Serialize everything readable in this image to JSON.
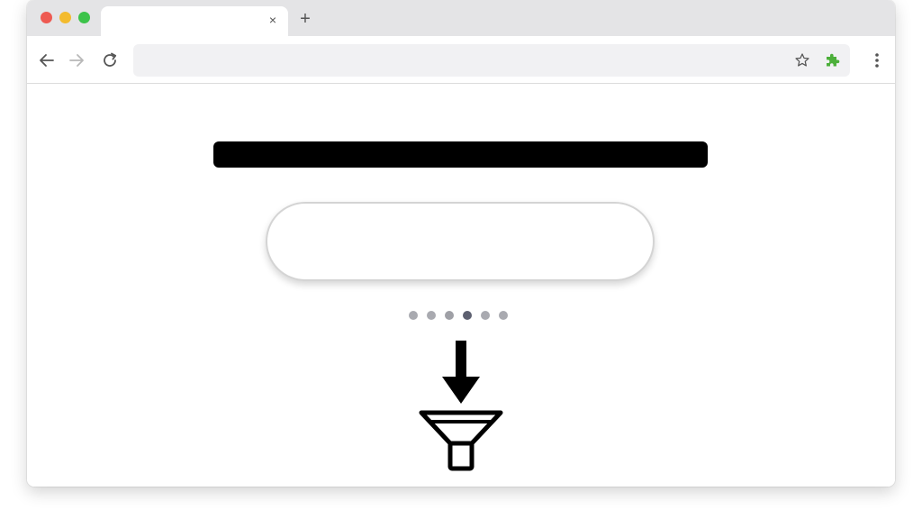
{
  "browser": {
    "tab": {
      "title": "",
      "close_glyph": "×"
    },
    "new_tab_glyph": "+",
    "address_bar": {
      "value": "",
      "placeholder": ""
    },
    "icons": {
      "back": "arrow-left-icon",
      "forward": "arrow-right-icon",
      "reload": "reload-icon",
      "bookmark": "star-icon",
      "extension": "puzzle-extension-icon",
      "menu": "kebab-menu-icon"
    },
    "colors": {
      "close": "#ee5a52",
      "minimize": "#f3bb2e",
      "maximize": "#3cc34a",
      "extension": "#4caf3a"
    }
  },
  "page": {
    "search": {
      "value": "",
      "placeholder": ""
    },
    "pagination": {
      "total": 6,
      "active_index": 3
    },
    "icons": {
      "arrow": "arrow-down-icon",
      "funnel": "funnel-filter-icon"
    }
  }
}
